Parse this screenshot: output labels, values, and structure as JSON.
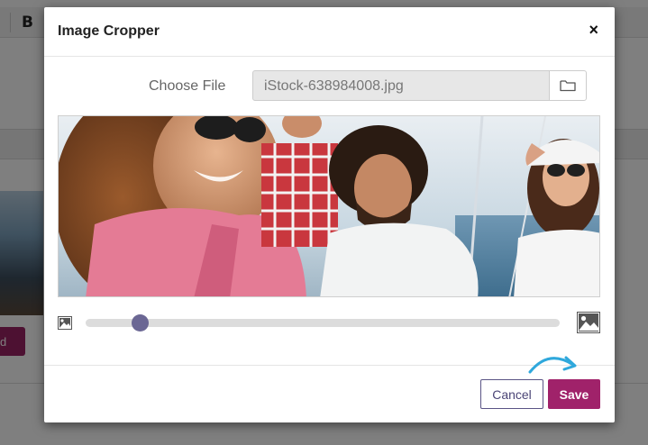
{
  "background": {
    "toolbar_bold": "B",
    "button_fragment": "d"
  },
  "modal": {
    "title": "Image Cropper",
    "close_symbol": "×",
    "file": {
      "label": "Choose File",
      "value": "iStock-638984008.jpg"
    },
    "zoom": {
      "level_fraction": 0.1
    },
    "footer": {
      "cancel_label": "Cancel",
      "save_label": "Save"
    }
  },
  "icons": {
    "close": "close-icon",
    "folder": "folder-icon",
    "zoom_out": "image-small-icon",
    "zoom_in": "image-large-icon",
    "hint": "curved-arrow-icon"
  },
  "colors": {
    "accent": "#a0226a",
    "secondary": "#5a5485",
    "slider_thumb": "#6b6794",
    "hint_arrow": "#2fa8dc"
  }
}
